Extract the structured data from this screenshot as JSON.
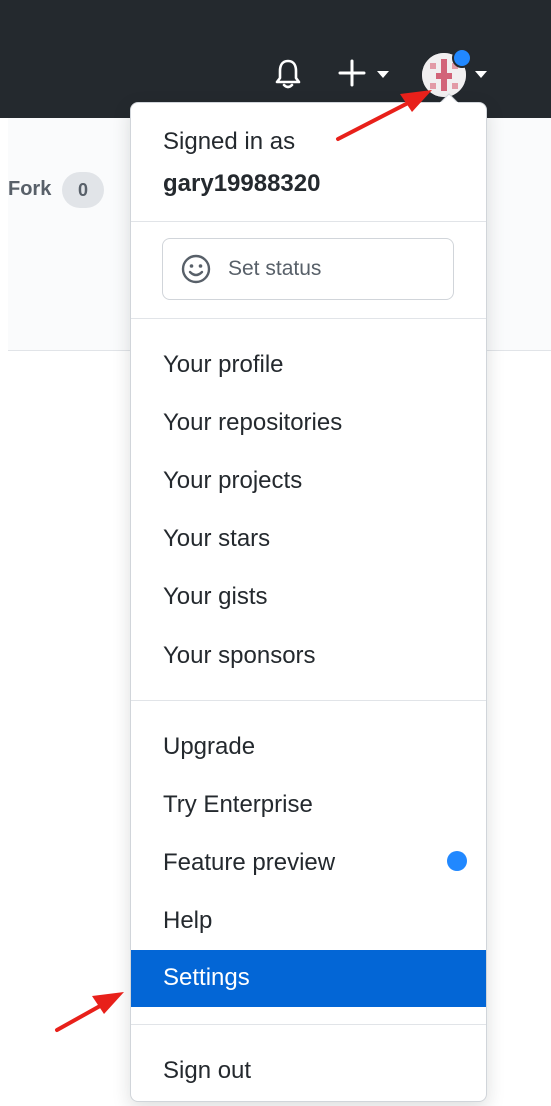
{
  "header": {
    "bell_icon": "bell-icon",
    "plus_icon": "plus-icon",
    "avatar_icon": "user-avatar",
    "notification_dot_color": "#2188ff",
    "background_color": "#24292e"
  },
  "repo": {
    "fork_label": "Fork",
    "fork_count": "0"
  },
  "dropdown": {
    "signed_in_label": "Signed in as",
    "username": "gary19988320",
    "status_icon": "smiley-icon",
    "set_status_label": "Set status",
    "section_1": [
      "Your profile",
      "Your repositories",
      "Your projects",
      "Your stars",
      "Your gists",
      "Your sponsors"
    ],
    "section_2": [
      "Upgrade",
      "Try Enterprise",
      "Feature preview",
      "Help"
    ],
    "settings_label": "Settings",
    "sign_out_label": "Sign out",
    "highlight_color": "#0366d6",
    "feature_dot_color": "#2188ff"
  },
  "annotation": {
    "arrow_color": "#e8201a"
  }
}
